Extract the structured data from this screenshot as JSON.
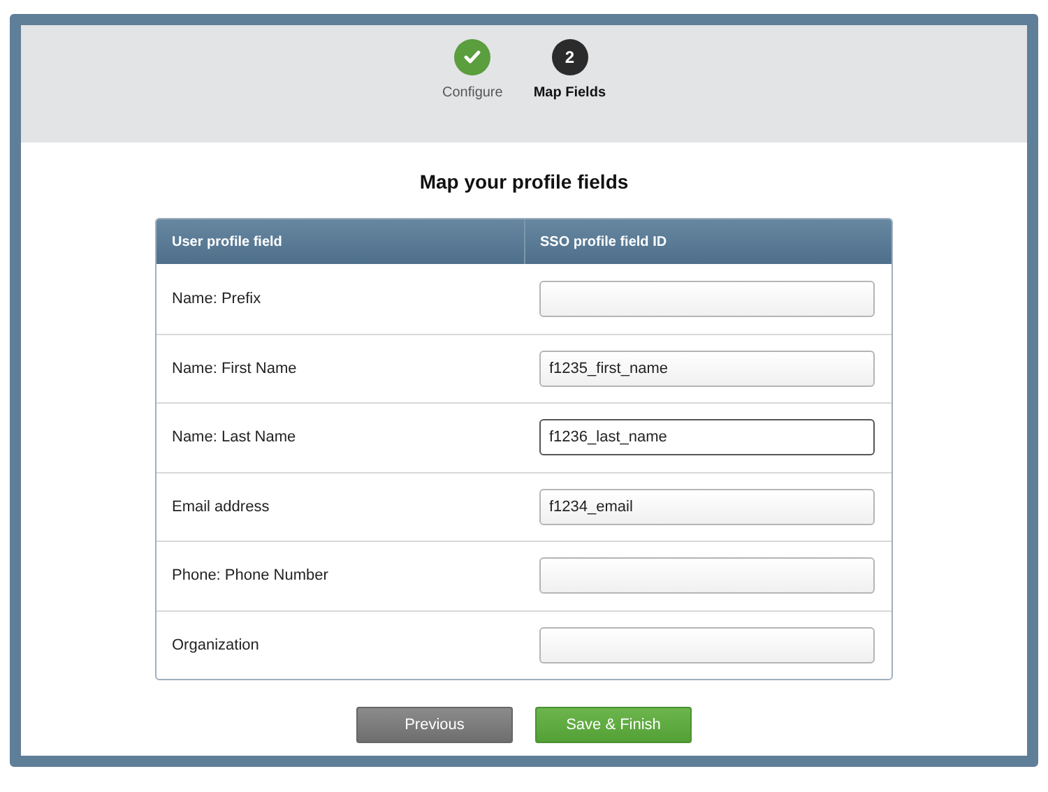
{
  "steps": [
    {
      "label": "Configure",
      "kind": "done"
    },
    {
      "number": "2",
      "label": "Map Fields",
      "kind": "current"
    }
  ],
  "title": "Map your profile fields",
  "table": {
    "columns": [
      "User profile field",
      "SSO profile field ID"
    ],
    "rows": [
      {
        "label": "Name: Prefix",
        "value": "",
        "focused": false
      },
      {
        "label": "Name: First Name",
        "value": "f1235_first_name",
        "focused": false
      },
      {
        "label": "Name: Last Name",
        "value": "f1236_last_name",
        "focused": true
      },
      {
        "label": "Email address",
        "value": "f1234_email",
        "focused": false
      },
      {
        "label": "Phone: Phone Number",
        "value": "",
        "focused": false
      },
      {
        "label": "Organization",
        "value": "",
        "focused": false
      }
    ]
  },
  "buttons": [
    {
      "label": "Previous",
      "kind": "secondary"
    },
    {
      "label": "Save & Finish",
      "kind": "primary"
    }
  ]
}
